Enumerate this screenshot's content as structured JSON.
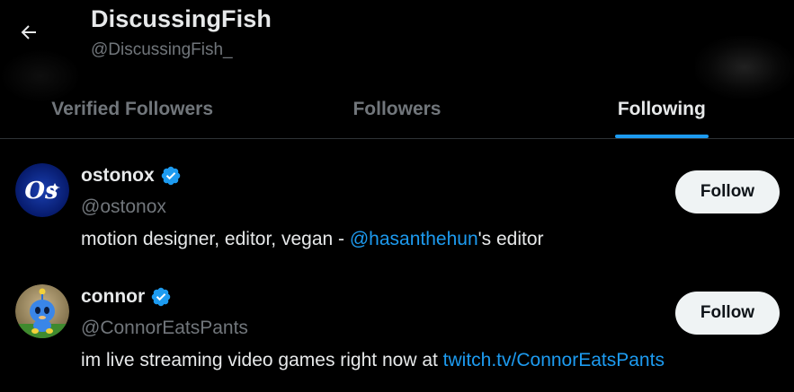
{
  "header": {
    "title": "DiscussingFish",
    "handle": "@DiscussingFish_",
    "back_icon": "arrow-left-icon"
  },
  "tabs": [
    {
      "label": "Verified Followers",
      "active": false
    },
    {
      "label": "Followers",
      "active": false
    },
    {
      "label": "Following",
      "active": true
    }
  ],
  "users": [
    {
      "name": "ostonox",
      "handle": "@ostonox",
      "verified": true,
      "avatar_text": "Os",
      "bio_prefix": "motion designer, editor, vegan - ",
      "bio_link": "@hasanthehun",
      "bio_suffix": "'s editor",
      "follow_label": "Follow"
    },
    {
      "name": "connor",
      "handle": "@ConnorEatsPants",
      "verified": true,
      "bio_prefix": "im live streaming video games right now at ",
      "bio_link": "twitch.tv/ConnorEatsPants",
      "bio_suffix": "",
      "follow_label": "Follow"
    }
  ],
  "colors": {
    "background": "#000000",
    "text_primary": "#e7e9ea",
    "text_secondary": "#71767b",
    "accent": "#1d9bf0",
    "button_bg": "#eff3f4"
  }
}
